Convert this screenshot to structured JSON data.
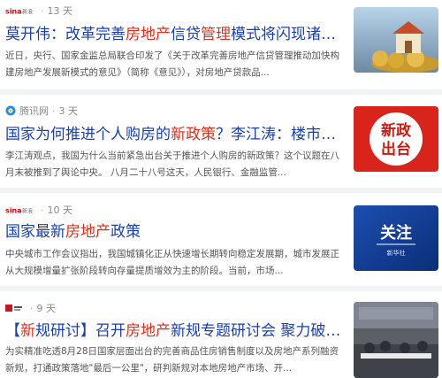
{
  "results": [
    {
      "source": "新浪财经",
      "age": "13 天",
      "title_parts": [
        {
          "t": "莫开伟：改革完善",
          "hl": false
        },
        {
          "t": "房地产",
          "hl": true
        },
        {
          "t": "信贷",
          "hl": false
        },
        {
          "t": "管理",
          "hl": true
        },
        {
          "t": "模式将闪现诸多...",
          "hl": false
        }
      ],
      "snippet": "近日，央行、国家金监总局联合印发了《关于改革完善房地产信贷管理推动加快构建房地产发展新模式的意见》（简称《意见》），对房地产贷款品..."
    },
    {
      "source": "腾讯网",
      "age": "3 天",
      "title_parts": [
        {
          "t": "国家为何推进个人购房的",
          "hl": false
        },
        {
          "t": "新政策",
          "hl": true
        },
        {
          "t": "？李江涛：楼市风...",
          "hl": false
        }
      ],
      "snippet": "李江涛观点，我国为什么当前紧急出台关于推进个人购房的新政策？这个议题在八月末被推到了舆论中央。 八月二十八号这天，人民银行、金融监管..."
    },
    {
      "source": "新浪财经",
      "age": "10 天",
      "title_parts": [
        {
          "t": "国家最新",
          "hl": false
        },
        {
          "t": "房地产",
          "hl": true
        },
        {
          "t": "政策",
          "hl": false
        }
      ],
      "snippet": "中央城市工作会议指出，我国城镇化正从快速增长期转向稳定发展期，城市发展正从大规模增量扩张阶段转向存量提质增效为主的阶段。当前，市场..."
    },
    {
      "source": "",
      "age": "9 天",
      "title_parts": [
        {
          "t": "【",
          "hl": false
        },
        {
          "t": "新",
          "hl": true
        },
        {
          "t": "规研讨】召开",
          "hl": false
        },
        {
          "t": "房地产",
          "hl": true
        },
        {
          "t": "新规专题研讨会 聚力破解...",
          "hl": false
        }
      ],
      "snippet": "为实精准吃透8月28日国家层面出台的完善商品住房销售制度以及房地产系列融资新规，打通政策落地\"最后一公里\"，研判新规对本地房地产市场、开..."
    }
  ],
  "thumbs": {
    "r2_text": [
      "新政",
      "出台"
    ],
    "r3_text": "关注",
    "r3_sub": "新华社"
  },
  "colors": {
    "title": "#1a3fb3",
    "highlight": "#e0301e",
    "divider": "#f2f3f5"
  }
}
